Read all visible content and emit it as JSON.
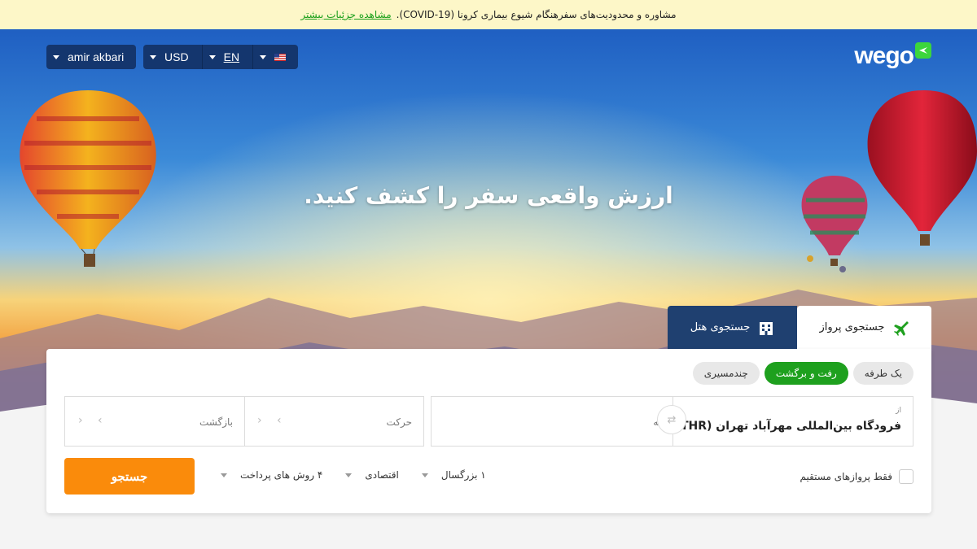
{
  "banner": {
    "text": "مشاوره و محدودیت‌های سفرهنگام شیوع بیماری کرونا (COVID-19).",
    "link": "مشاهده جزئیات بیشتر"
  },
  "top_controls": {
    "user": "amir akbari",
    "currency": "USD",
    "language": "EN"
  },
  "logo": {
    "text": "wego"
  },
  "headline": "ارزش واقعی سفر را کشف کنید.",
  "tabs": [
    {
      "label": "جستجوی پرواز",
      "icon": "plane-icon",
      "active": true
    },
    {
      "label": "جستجوی هتل",
      "icon": "building-icon",
      "active": false
    }
  ],
  "trip_types": [
    {
      "label": "یک طرفه",
      "selected": false
    },
    {
      "label": "رفت و برگشت",
      "selected": true
    },
    {
      "label": "چندمسیری",
      "selected": false
    }
  ],
  "form": {
    "from_label": "از",
    "from_value": "فرودگاه بین‌المللی مهرآباد تهران (THR)",
    "to_placeholder": "به",
    "depart_placeholder": "حرکت",
    "return_placeholder": "بازگشت",
    "direct_only": "فقط پروازهای مستقیم",
    "passengers": "۱ بزرگسال",
    "cabin": "اقتصادی",
    "payment": "۴ روش های پرداخت",
    "search_button": "جستجو"
  },
  "colors": {
    "accent_green": "#1ea01e",
    "search_orange": "#fa8b0b",
    "control_navy": "#14366e",
    "link_green": "#1ca01c"
  }
}
